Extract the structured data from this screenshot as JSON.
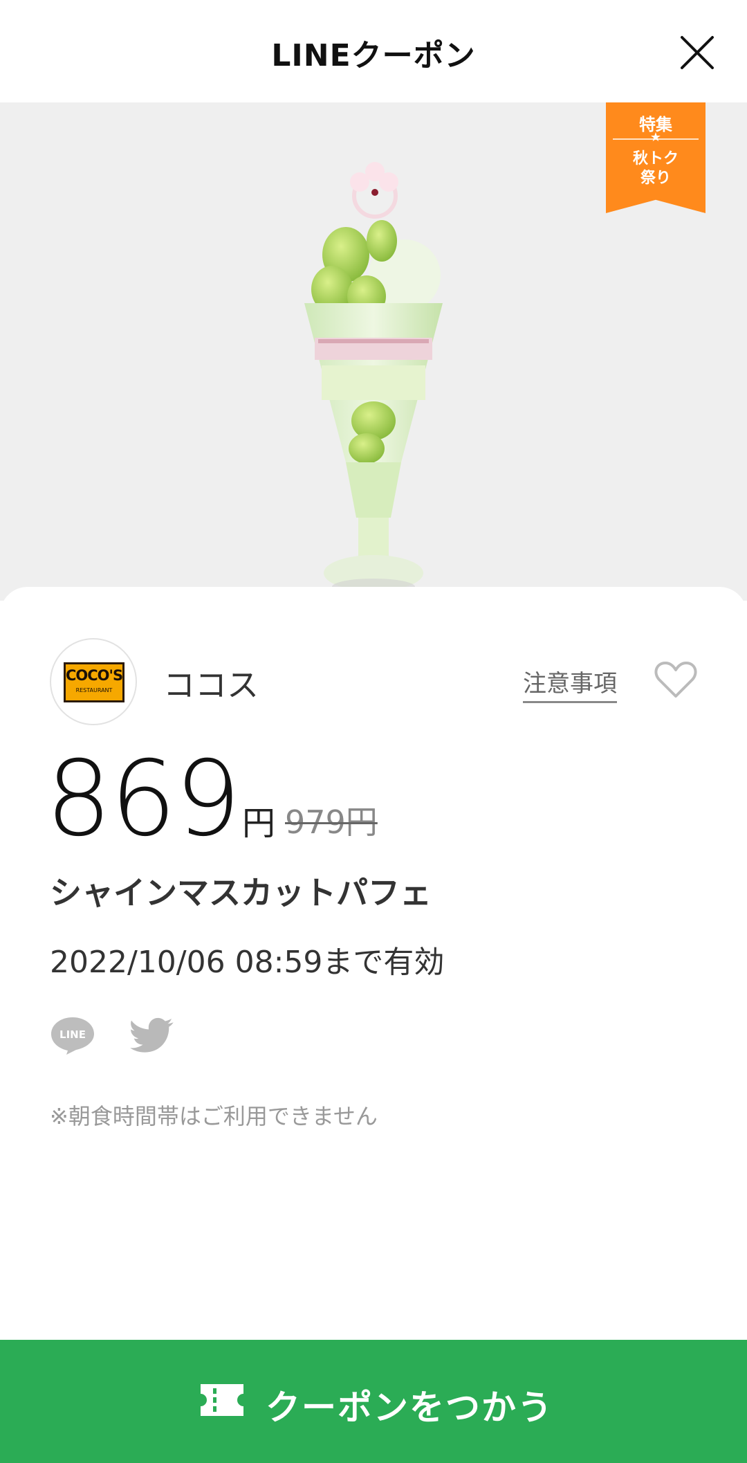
{
  "header": {
    "title": "LINEクーポン",
    "close_icon": "close-icon"
  },
  "hero": {
    "ribbon_top": "特集",
    "ribbon_star": "★",
    "ribbon_bottom": "秋トク\n祭り",
    "ribbon_color": "#ff8a1c",
    "image_subject": "parfait"
  },
  "store": {
    "logo_text": "COCO'S",
    "logo_subtext": "RESTAURANT",
    "name": "ココス",
    "notice_label": "注意事項",
    "favorite_icon": "heart-outline-icon"
  },
  "offer": {
    "price": "869",
    "currency": "円",
    "original_price": "979円",
    "item_name": "シャインマスカットパフェ",
    "expiry": "2022/10/06 08:59まで有効"
  },
  "share": {
    "line_icon": "line-share-icon",
    "line_text": "LINE",
    "twitter_icon": "twitter-share-icon"
  },
  "note": "※朝食時間帯はご利用できません",
  "cta": {
    "label": "クーポンをつかう",
    "icon": "ticket-icon",
    "color": "#2bac55"
  }
}
